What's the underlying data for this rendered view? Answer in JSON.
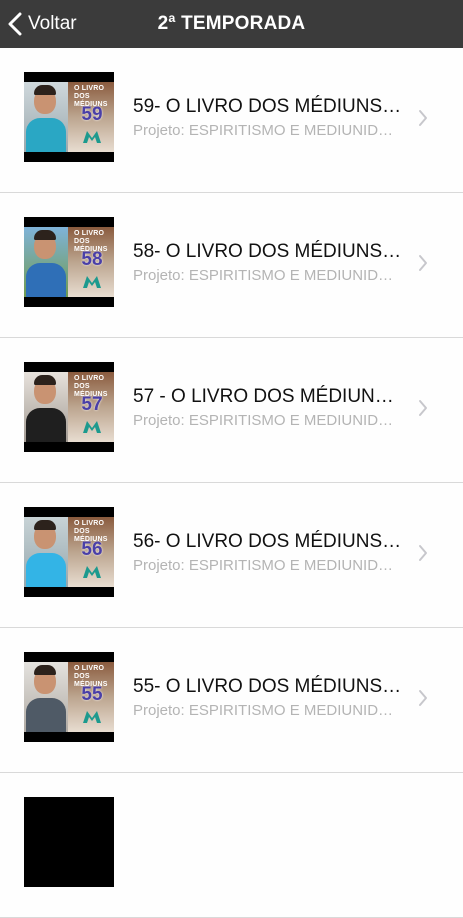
{
  "navbar": {
    "back_label": "Voltar",
    "title": "2ª TEMPORADA"
  },
  "items": [
    {
      "title": "59- O LIVRO DOS MÉDIUNS …",
      "subtitle": "Projeto: ESPIRITISMO E MEDIUNID…",
      "thumb_caption": "O LIVRO DOS MÉDIUNS",
      "thumb_number": "59",
      "shirt_color": "#2aa7c4"
    },
    {
      "title": "58- O LIVRO DOS MÉDIUNS …",
      "subtitle": "Projeto: ESPIRITISMO E MEDIUNID…",
      "thumb_caption": "O LIVRO DOS MÉDIUNS",
      "thumb_number": "58",
      "shirt_color": "#2f6fb7"
    },
    {
      "title": "57 - O LIVRO DOS MÉDIUNS …",
      "subtitle": "Projeto: ESPIRITISMO E MEDIUNID…",
      "thumb_caption": "O LIVRO DOS MÉDIUNS",
      "thumb_number": "57",
      "shirt_color": "#1f1f1f"
    },
    {
      "title": "56- O LIVRO DOS MÉDIUNS …",
      "subtitle": "Projeto: ESPIRITISMO E MEDIUNID…",
      "thumb_caption": "O LIVRO DOS MÉDIUNS",
      "thumb_number": "56",
      "shirt_color": "#33b4e6"
    },
    {
      "title": "55- O LIVRO DOS MÉDIUNS …",
      "subtitle": "Projeto: ESPIRITISMO E MEDIUNID…",
      "thumb_caption": "O LIVRO DOS MÉDIUNS",
      "thumb_number": "55",
      "shirt_color": "#4f5a66"
    }
  ]
}
